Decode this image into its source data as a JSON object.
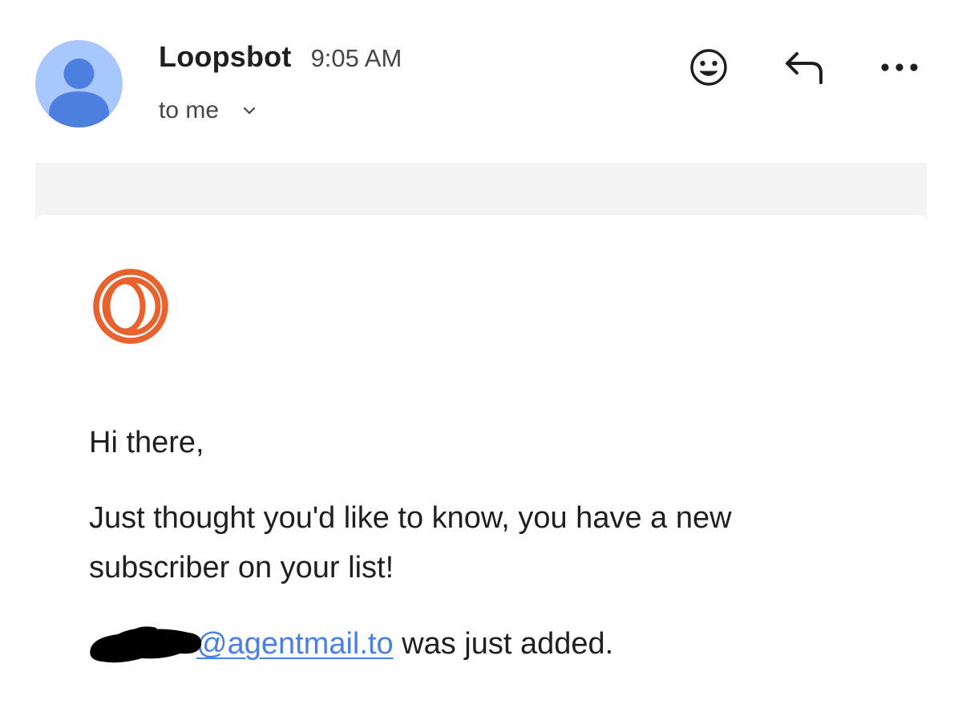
{
  "message": {
    "sender_name": "Loopsbot",
    "time": "9:05 AM",
    "recipient": "to me"
  },
  "header_actions": {
    "emoji_icon": "smiley-face-icon",
    "reply_icon": "reply-arrow-icon",
    "more_icon": "more-options-dots-icon"
  },
  "avatar_icon": "default-user-icon",
  "body": {
    "logo_icon": "loops-logo-icon",
    "greeting": "Hi there,",
    "paragraph": "Just thought you'd like to know, you have a new subscriber on your list!",
    "email_visible_part": "@agentmail.to",
    "added_suffix": " was just added."
  },
  "colors": {
    "avatar_bg": "#a8c7fa",
    "avatar_fg": "#4d7fe0",
    "logo": "#e8622d",
    "link": "#4a7fe8",
    "band": "#f4f4f4"
  }
}
